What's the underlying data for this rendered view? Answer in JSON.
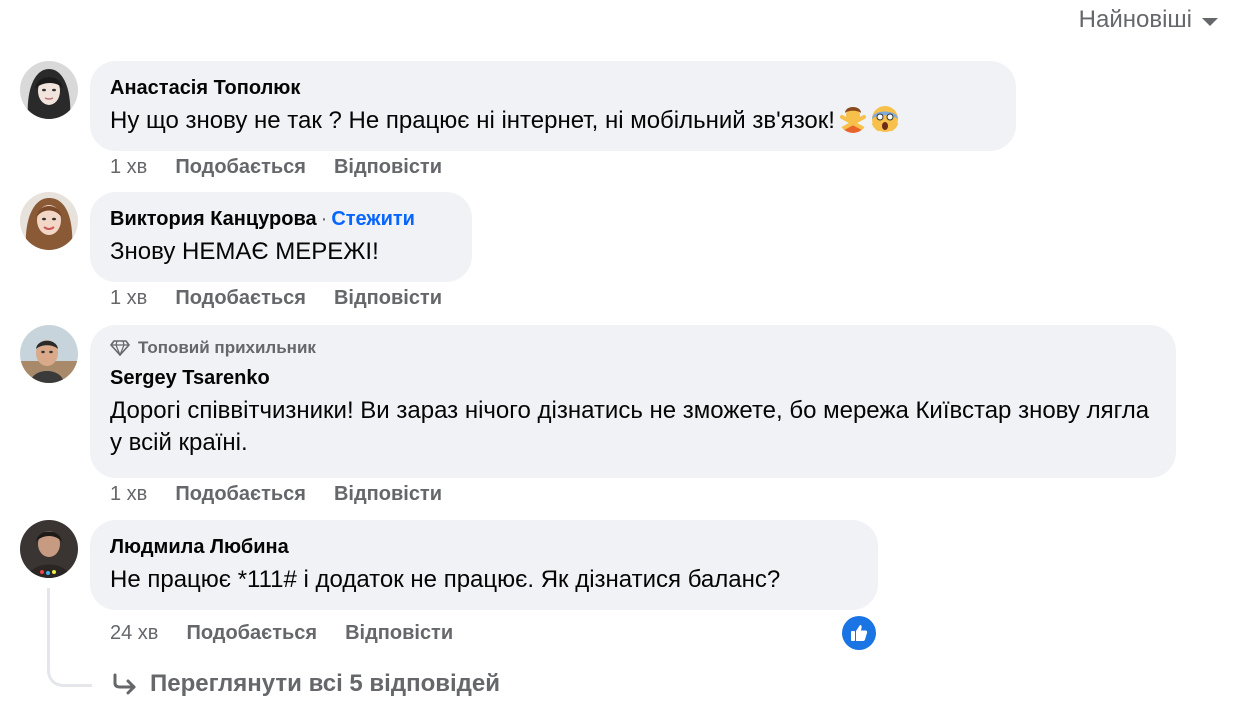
{
  "sort": {
    "label": "Найновіші"
  },
  "comments": [
    {
      "author": "Анастасія Тополюк",
      "text": "Ну що знову не так ? Не працює ні інтернет, ні мобільний зв'язок!",
      "emoji": [
        "person-gesturing-no-emoji",
        "face-screaming-emoji"
      ],
      "time": "1 хв",
      "like_label": "Подобається",
      "reply_label": "Відповісти"
    },
    {
      "author": "Виктория Канцурова",
      "separator": "·",
      "follow_label": "Стежити",
      "text": "Знову НЕМАЄ МЕРЕЖІ!",
      "time": "1 хв",
      "like_label": "Подобається",
      "reply_label": "Відповісти"
    },
    {
      "badge": "Топовий прихильник",
      "author": "Sergey Tsarenko",
      "text": "Дорогі співвітчизники! Ви зараз нічого дізнатись не зможете, бо мережа Київстар знову лягла у всій країні.",
      "time": "1 хв",
      "like_label": "Подобається",
      "reply_label": "Відповісти"
    },
    {
      "author": "Людмила Любина",
      "text": "Не працює *111# і додаток не працює. Як дізнатися баланс?",
      "time": "24 хв",
      "like_label": "Подобається",
      "reply_label": "Відповісти",
      "reaction": "like-icon"
    }
  ],
  "view_replies": {
    "label": "Переглянути всі 5 відповідей"
  },
  "colors": {
    "accent": "#0866ff",
    "bubble": "#f0f2f5",
    "muted": "#65676b",
    "like": "#1b74e4"
  }
}
